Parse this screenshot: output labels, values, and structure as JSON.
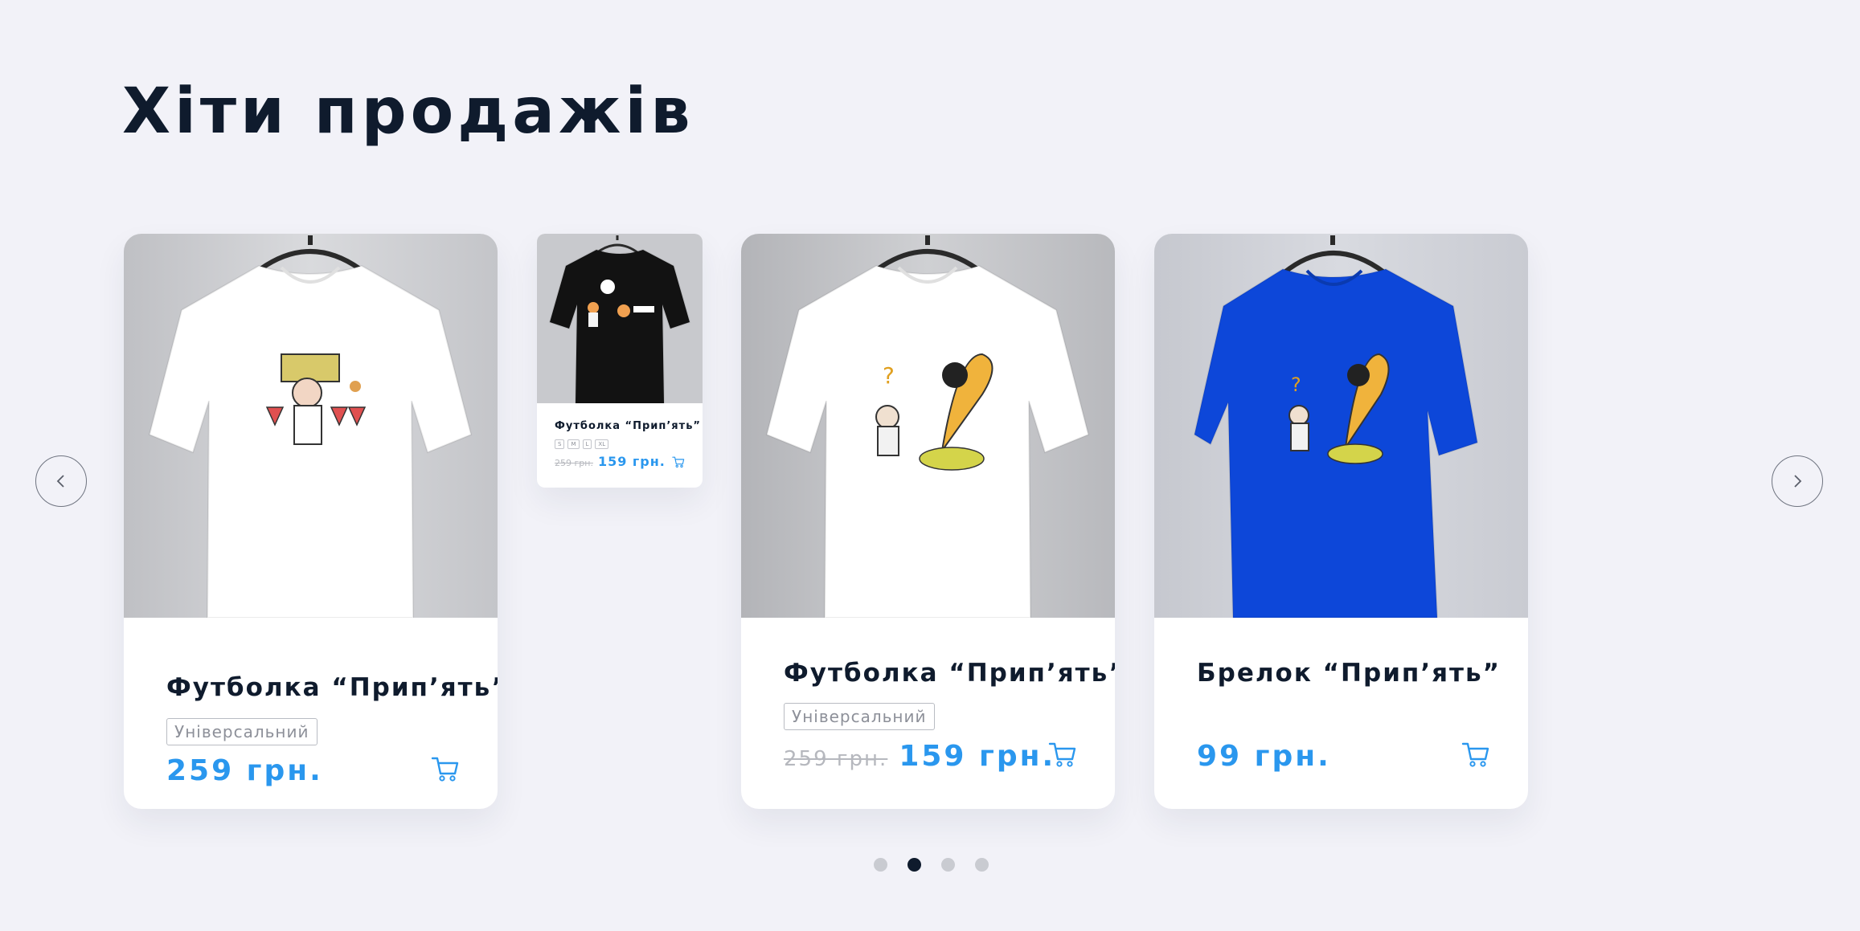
{
  "section": {
    "title": "Хіти продажів"
  },
  "nav": {
    "prev_icon": "chevron-left-icon",
    "next_icon": "chevron-right-icon"
  },
  "products": [
    {
      "name": "Футболка “Прип’ять”",
      "tag": "Універсальний",
      "price": "259 грн.",
      "shirt_color": "#ffffff",
      "cart_icon": "cart-icon"
    },
    {
      "name": "Футболка “Прип’ять”",
      "sizes": [
        "S",
        "M",
        "L",
        "XL"
      ],
      "old_price": "259 грн.",
      "price": "159 грн.",
      "shirt_color": "#121212",
      "cart_icon": "cart-icon"
    },
    {
      "name": "Футболка “Прип’ять”",
      "tag": "Універсальний",
      "old_price": "259 грн.",
      "price": "159 грн.",
      "shirt_color": "#ffffff",
      "cart_icon": "cart-icon"
    },
    {
      "name": "Брелок “Прип’ять”",
      "price": "99 грн.",
      "shirt_color": "#0d47d9",
      "cart_icon": "cart-icon"
    }
  ],
  "pagination": {
    "count": 4,
    "active_index": 1
  },
  "colors": {
    "background": "#f2f2f8",
    "accent": "#2a97ee",
    "title": "#0f1b2d"
  }
}
